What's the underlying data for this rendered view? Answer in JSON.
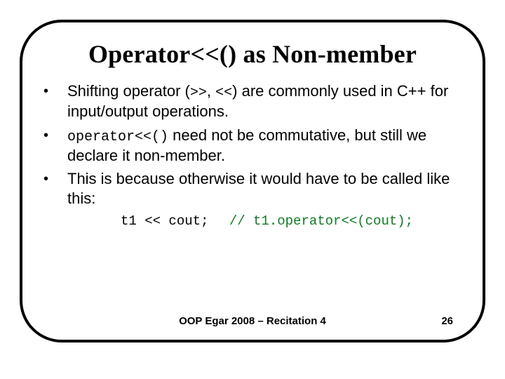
{
  "title": "Operator<<() as Non-member",
  "bullets": [
    {
      "pre": "Shifting operator (",
      "mono1": ">>",
      "mid": ", ",
      "mono2": "<<",
      "post": ") are commonly used in C++ for input/output operations."
    },
    {
      "mono1": "operator<<()",
      "post": " need not be commutative, but still we declare it non-member."
    },
    {
      "pre": "This is because otherwise it would have to be called like this:"
    }
  ],
  "code": {
    "stmt": "t1 << cout;",
    "comment": "// t1.operator<<(cout);"
  },
  "footer": "OOP Egar 2008 – Recitation 4",
  "page": "26"
}
